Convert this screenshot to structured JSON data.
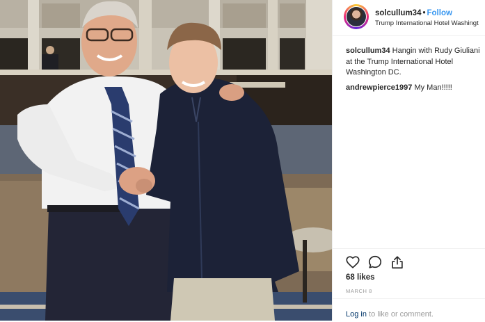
{
  "post": {
    "username": "solcullum34",
    "follow_label": "Follow",
    "separator": "•",
    "location": "Trump International Hotel Washingt"
  },
  "comments": [
    {
      "user": "solcullum34",
      "text": "Hangin with Rudy Giuliani at the Trump International Hotel Washington DC."
    },
    {
      "user": "andrewpierce1997",
      "text": "My Man!!!!!"
    }
  ],
  "actions": {
    "like_icon": "heart-icon",
    "comment_icon": "comment-icon",
    "share_icon": "share-icon"
  },
  "stats": {
    "likes": "68 likes",
    "date": "MARCH 8"
  },
  "login": {
    "link_label": "Log in",
    "suffix": " to like or comment."
  },
  "colors": {
    "link_blue": "#3897f0",
    "dark_link": "#003569",
    "muted": "#999999",
    "divider": "#efefef"
  }
}
